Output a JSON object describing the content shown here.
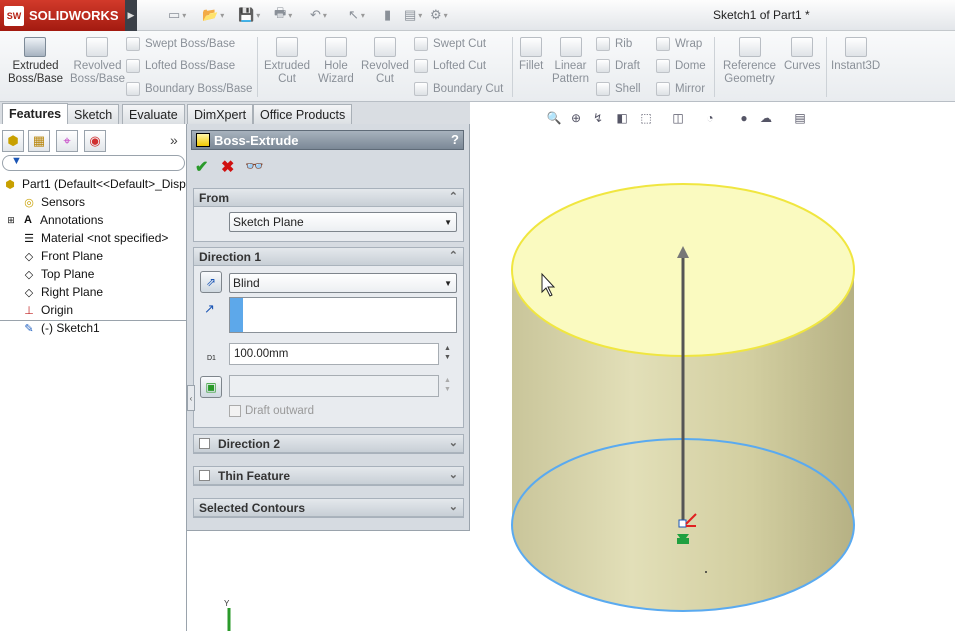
{
  "app": {
    "logo": "SOLIDWORKS",
    "logo_badge": "SW",
    "doc_title": "Sketch1 of Part1 *"
  },
  "ribbon": {
    "big": [
      {
        "line1": "Extruded",
        "line2": "Boss/Base"
      },
      {
        "line1": "Revolved",
        "line2": "Boss/Base"
      },
      {
        "line1": "Extruded",
        "line2": "Cut"
      },
      {
        "line1": "Hole",
        "line2": "Wizard"
      },
      {
        "line1": "Revolved",
        "line2": "Cut"
      },
      {
        "line1": "Fillet",
        "line2": ""
      },
      {
        "line1": "Linear",
        "line2": "Pattern"
      },
      {
        "line1": "Reference",
        "line2": "Geometry"
      },
      {
        "line1": "Curves",
        "line2": ""
      },
      {
        "line1": "Instant3D",
        "line2": ""
      }
    ],
    "small": {
      "swept_boss": "Swept Boss/Base",
      "lofted_boss": "Lofted Boss/Base",
      "boundary_boss": "Boundary Boss/Base",
      "swept_cut": "Swept Cut",
      "lofted_cut": "Lofted Cut",
      "boundary_cut": "Boundary Cut",
      "rib": "Rib",
      "draft": "Draft",
      "shell": "Shell",
      "wrap": "Wrap",
      "dome": "Dome",
      "mirror": "Mirror"
    }
  },
  "tabs": [
    "Features",
    "Sketch",
    "Evaluate",
    "DimXpert",
    "Office Products"
  ],
  "tree": {
    "root": "Part1  (Default<<Default>_Disp",
    "items": [
      "Sensors",
      "Annotations",
      "Material <not specified>",
      "Front Plane",
      "Top Plane",
      "Right Plane",
      "Origin",
      "(-) Sketch1"
    ],
    "more": "»"
  },
  "pm": {
    "title": "Boss-Extrude",
    "help": "?",
    "from": {
      "header": "From",
      "value": "Sketch Plane"
    },
    "direction1": {
      "header": "Direction 1",
      "end_condition": "Blind",
      "depth": "100.00mm",
      "draft_label": "Draft outward",
      "d1_label": "D1"
    },
    "direction2": {
      "header": "Direction 2"
    },
    "thin": {
      "header": "Thin Feature"
    },
    "contours": {
      "header": "Selected Contours"
    }
  },
  "colors": {
    "accent": "#3aa0e8",
    "top_face": "#fafac0",
    "top_edge": "#f0e640",
    "bottom_edge": "#5aaaf0",
    "cylinder": "#d6d3a6"
  }
}
